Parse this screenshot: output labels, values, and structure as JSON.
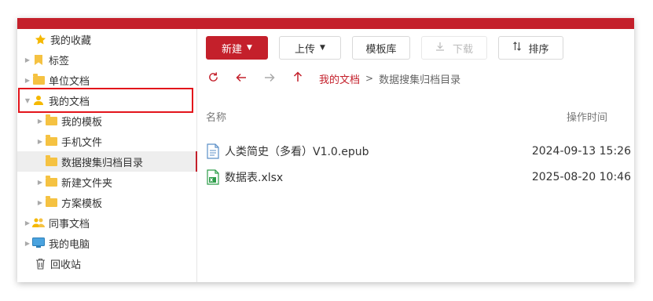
{
  "colors": {
    "brand": "#c4202b",
    "folder": "#f5c242",
    "selection": "#eeeeee",
    "highlight_box": "#e3141b"
  },
  "sidebar": {
    "items": [
      {
        "label": "我的收藏",
        "icon": "star-icon"
      },
      {
        "label": "标签",
        "icon": "bookmark-icon"
      },
      {
        "label": "单位文档",
        "icon": "folder-icon"
      },
      {
        "label": "我的文档",
        "icon": "user-icon"
      },
      {
        "label": "我的模板",
        "icon": "folder-icon"
      },
      {
        "label": "手机文件",
        "icon": "folder-icon"
      },
      {
        "label": "数据搜集归档目录",
        "icon": "folder-icon"
      },
      {
        "label": "新建文件夹",
        "icon": "folder-icon"
      },
      {
        "label": "方案模板",
        "icon": "folder-icon"
      },
      {
        "label": "同事文档",
        "icon": "colleagues-icon"
      },
      {
        "label": "我的电脑",
        "icon": "computer-icon"
      },
      {
        "label": "回收站",
        "icon": "trash-icon"
      }
    ]
  },
  "toolbar": {
    "new_label": "新建",
    "upload_label": "上传",
    "template_label": "模板库",
    "download_label": "下载",
    "sort_label": "排序"
  },
  "breadcrumb": {
    "root": "我的文档",
    "separator": ">",
    "current": "数据搜集归档目录"
  },
  "list": {
    "col_name": "名称",
    "col_time": "操作时间",
    "files": [
      {
        "name": "人类简史（多看）V1.0.epub",
        "time": "2024-09-13 15:26",
        "icon": "epub-file-icon"
      },
      {
        "name": "数据表.xlsx",
        "time": "2025-08-20 10:46",
        "icon": "excel-file-icon"
      }
    ]
  }
}
